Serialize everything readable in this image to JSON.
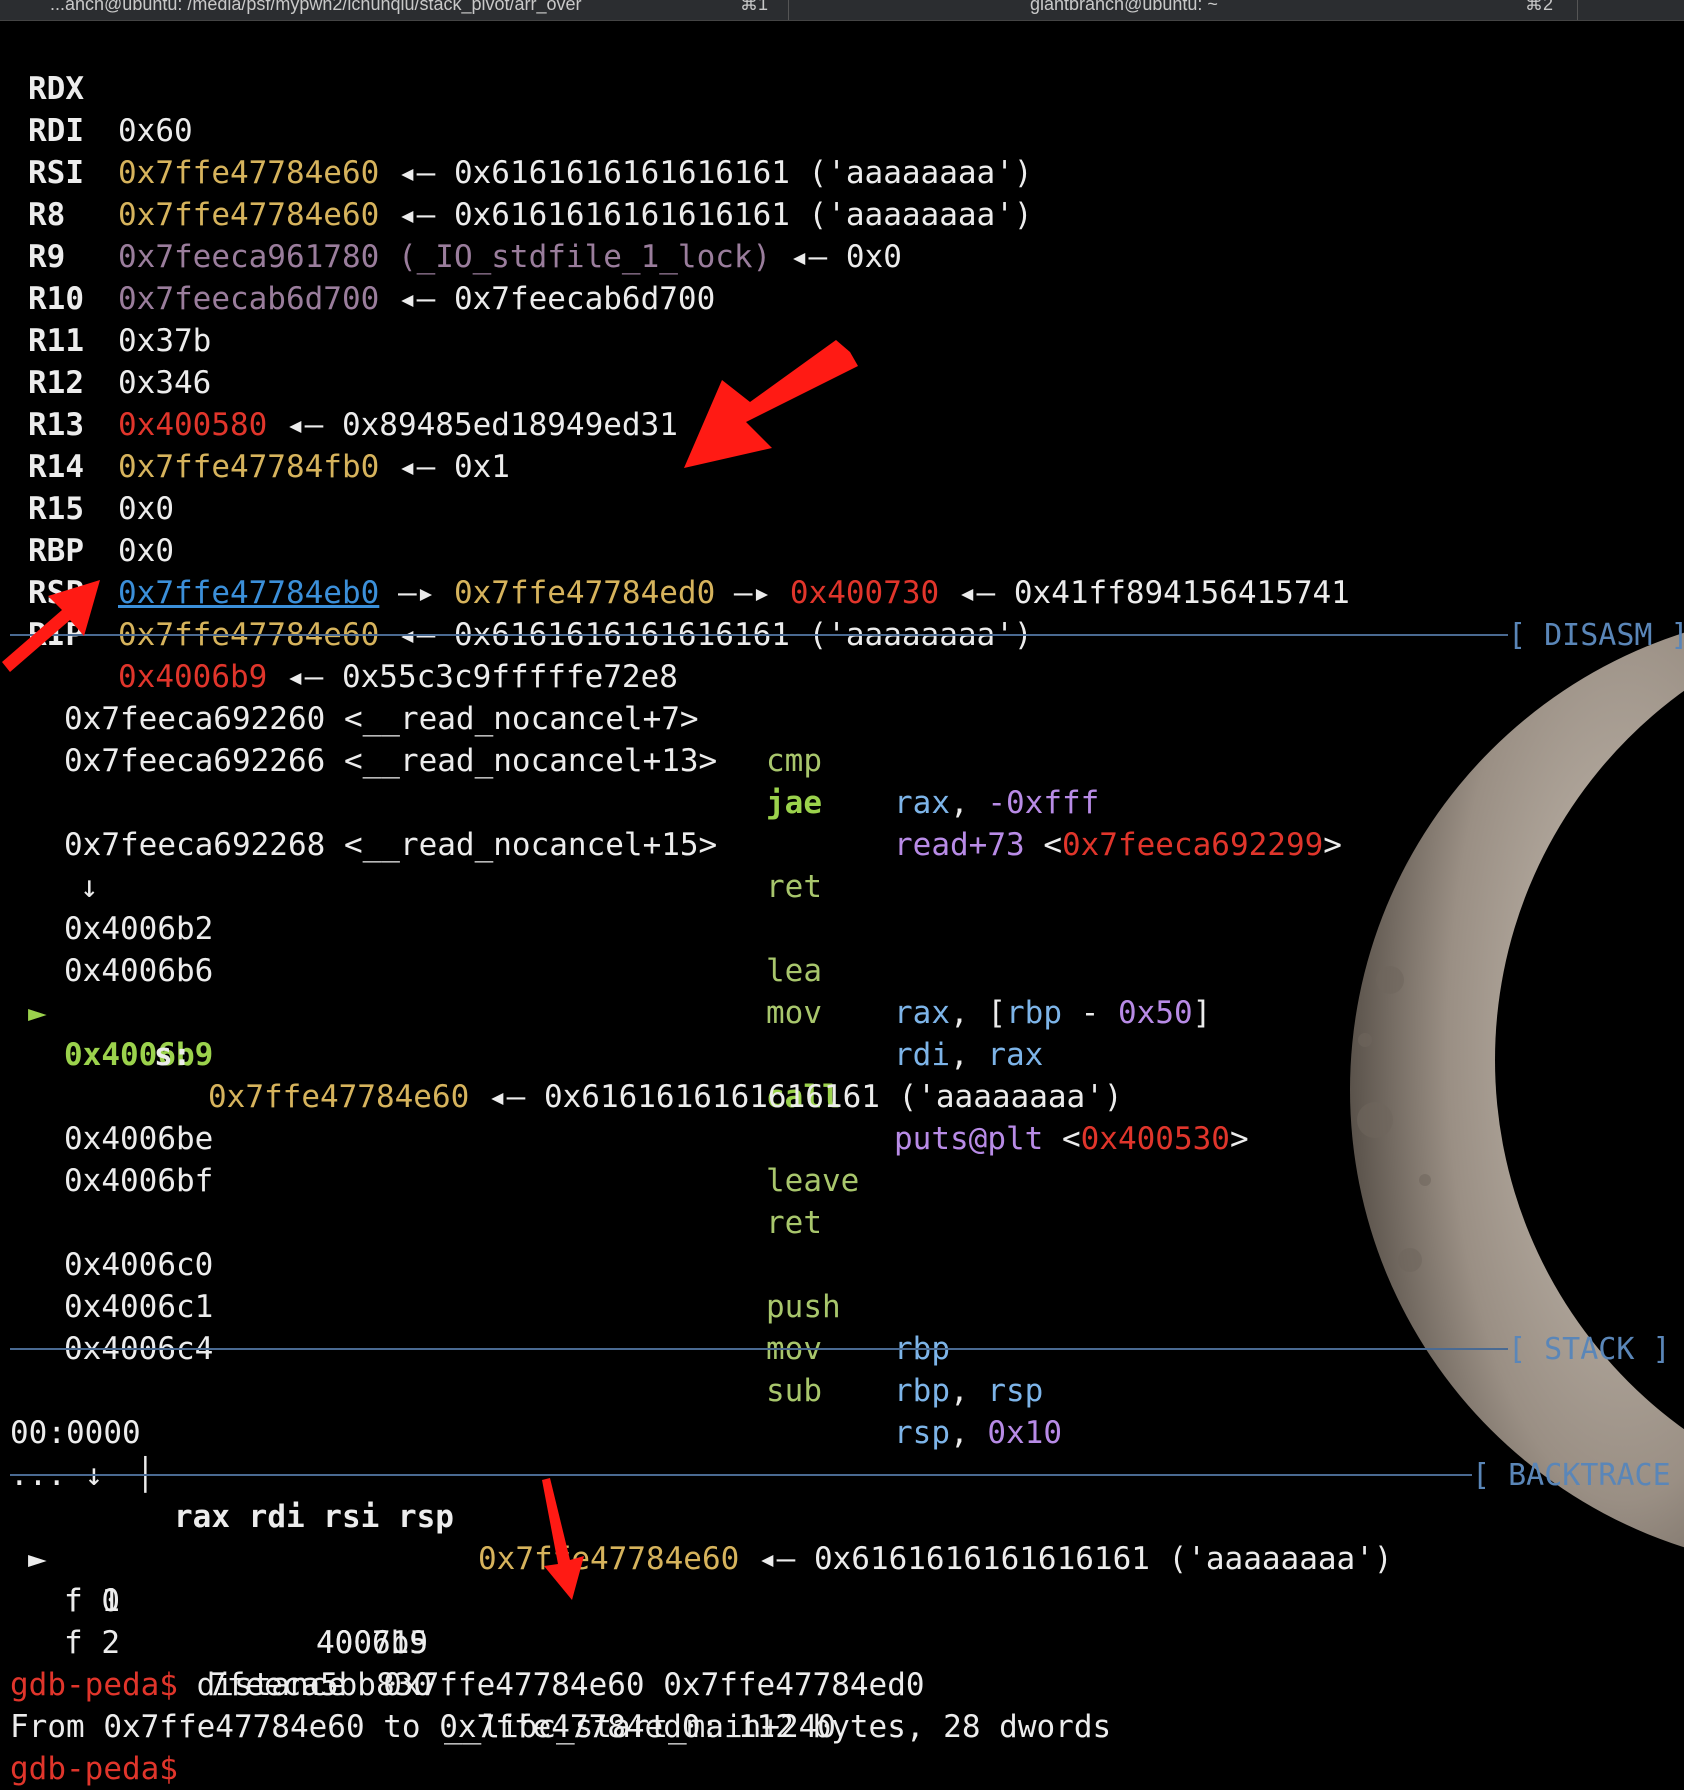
{
  "window": {
    "tab1_title": "...anch@ubuntu: /media/psf/mypwn2/ichunqiu/stack_pivot/arr_over",
    "tab1_shortcut": "⌘1",
    "tab2_title": "giantbranch@ubuntu: ~",
    "tab2_shortcut": "⌘2"
  },
  "registers": [
    {
      "name": "RDX",
      "value": "0x60",
      "rest": ""
    },
    {
      "name": "RDI",
      "value": "0x7ffe47784e60",
      "rest": " ◂— 0x6161616161616161 ('aaaaaaaa')"
    },
    {
      "name": "RSI",
      "value": "0x7ffe47784e60",
      "rest": " ◂— 0x6161616161616161 ('aaaaaaaa')"
    },
    {
      "name": "R8",
      "value": "0x7feeca961780 (_IO_stdfile_1_lock)",
      "rest": " ◂— 0x0"
    },
    {
      "name": "R9",
      "value": "0x7feecab6d700",
      "rest": " ◂— 0x7feecab6d700"
    },
    {
      "name": "R10",
      "value": "0x37b",
      "rest": ""
    },
    {
      "name": "R11",
      "value": "0x346",
      "rest": ""
    },
    {
      "name": "R12",
      "value": "0x400580",
      "rest": " ◂— 0x89485ed18949ed31"
    },
    {
      "name": "R13",
      "value": "0x7ffe47784fb0",
      "rest": " ◂— 0x1"
    },
    {
      "name": "R14",
      "value": "0x0",
      "rest": ""
    },
    {
      "name": "R15",
      "value": "0x0",
      "rest": ""
    },
    {
      "name": "RBP",
      "value": "0x7ffe47784eb0",
      "arrow1": " —▸ ",
      "v2": "0x7ffe47784ed0",
      "arrow2": " —▸ ",
      "v3": "0x400730",
      "rest": " ◂— 0x41ff894156415741"
    },
    {
      "name": "RSP",
      "value": "0x7ffe47784e60",
      "rest": " ◂— 0x6161616161616161 ('aaaaaaaa')"
    },
    {
      "name": "RIP",
      "value": "0x4006b9",
      "rest": " ◂— 0x55c3c9fffffe72e8"
    }
  ],
  "sections": {
    "disasm": "[ DISASM ]",
    "stack": "[ STACK ]",
    "backtrace": "[ BACKTRACE ]"
  },
  "disasm": [
    {
      "addr": "0x7feeca692260 <__read_nocancel+7>",
      "mnemonic": "cmp",
      "op1": "rax",
      "sep": ", ",
      "op2": "-0xfff"
    },
    {
      "addr": "0x7feeca692266 <__read_nocancel+13>",
      "mnemonic": "jae",
      "op1": "read+73",
      "lt": " <",
      "target": "0x7feeca692299",
      "gt": ">"
    },
    {
      "addr": "0x7feeca692268 <__read_nocancel+15>",
      "mnemonic": "ret"
    },
    {
      "flow": "↓"
    },
    {
      "addr": "0x4006b2",
      "mnemonic": "lea",
      "op1": "rax",
      "sep": ", ",
      "bracket_open": "[",
      "reg": "rbp",
      "minus": " - ",
      "imm": "0x50",
      "bracket_close": "]"
    },
    {
      "addr": "0x4006b6",
      "mnemonic": "mov",
      "op1": "rdi",
      "sep": ", ",
      "op2": "rax"
    },
    {
      "cursor": "►",
      "addr": "0x4006b9",
      "mnemonic": "call",
      "op1": "puts@plt",
      "lt": " <",
      "target": "0x400530",
      "gt": ">"
    },
    {
      "arg_name": "s:",
      "arg_addr": "0x7ffe47784e60",
      "arg_rest": " ◂— 0x6161616161616161 ('aaaaaaaa')"
    },
    {
      "addr": "0x4006be",
      "mnemonic": "leave"
    },
    {
      "addr": "0x4006bf",
      "mnemonic": "ret"
    },
    {
      "addr": "0x4006c0",
      "mnemonic": "push",
      "op1": "rbp"
    },
    {
      "addr": "0x4006c1",
      "mnemonic": "mov",
      "op1": "rbp",
      "sep": ", ",
      "op2": "rsp"
    },
    {
      "addr": "0x4006c4",
      "mnemonic": "sub",
      "op1": "rsp",
      "sep": ", ",
      "op2": "0x10"
    }
  ],
  "stack": {
    "offset": "00:0000",
    "bar": "│",
    "regs": "rax rdi rsi rsp",
    "addr": "0x7ffe47784e60",
    "rest": " ◂— 0x6161616161616161 ('aaaaaaaa')",
    "more": "... ↓"
  },
  "backtrace": [
    {
      "marker": "►",
      "frame": "f 0",
      "addr": "4006b9",
      "sym": ""
    },
    {
      "marker": "",
      "frame": "f 1",
      "addr": "400715",
      "sym": ""
    },
    {
      "marker": "",
      "frame": "f 2",
      "addr": "7feeca5bb830",
      "sym": "__libc_start_main+240"
    }
  ],
  "console": {
    "prompt": "gdb-peda$",
    "command": " distance  0x7ffe47784e60 0x7ffe47784ed0",
    "output": "From 0x7ffe47784e60 to 0x7ffe47784ed0: 112 bytes, 28 dwords",
    "next_prompt": "gdb-peda$"
  },
  "colors": {
    "background": "#000000",
    "address_yellow": "#d6b35c",
    "code_red": "#e0352b",
    "heap_blue": "#3b8fd9",
    "mapped_purple": "#9a7d9c",
    "mnemonic_green": "#a8c66c",
    "section_blue": "#5a86b8",
    "annotation_arrow": "#ff1a14"
  },
  "icons": [
    "red-annotation-arrow",
    "moon-wallpaper"
  ]
}
